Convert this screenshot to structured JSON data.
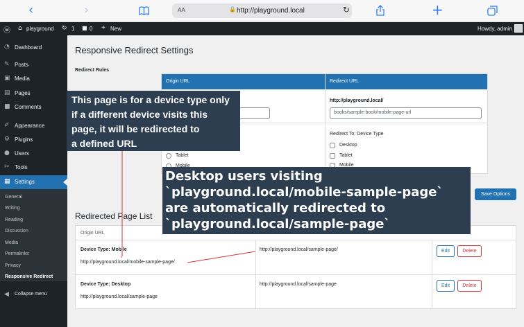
{
  "browser": {
    "back_icon": "chevron-left-icon",
    "forward_icon": "chevron-right-icon",
    "aa": "AA",
    "url": "http://playground.local",
    "share_icon": "share-icon",
    "plus_icon": "plus-icon",
    "tabs_icon": "tabs-icon"
  },
  "adminbar": {
    "site": "playground",
    "updates": "1",
    "comments": "0",
    "new": "New",
    "howdy": "Howdy, admin"
  },
  "sidebar": {
    "items": [
      {
        "label": "Dashboard",
        "icon": "dashboard-icon"
      },
      {
        "label": "Posts",
        "icon": "pin-icon"
      },
      {
        "label": "Media",
        "icon": "media-icon"
      },
      {
        "label": "Pages",
        "icon": "page-icon"
      },
      {
        "label": "Comments",
        "icon": "comment-icon"
      },
      {
        "label": "Appearance",
        "icon": "brush-icon"
      },
      {
        "label": "Plugins",
        "icon": "plugin-icon"
      },
      {
        "label": "Users",
        "icon": "user-icon"
      },
      {
        "label": "Tools",
        "icon": "wrench-icon"
      },
      {
        "label": "Settings",
        "icon": "settings-icon"
      }
    ],
    "submenu": [
      "General",
      "Writing",
      "Reading",
      "Discussion",
      "Media",
      "Permalinks",
      "Privacy",
      "Responsive Redirect"
    ],
    "collapse": "Collapse menu"
  },
  "main": {
    "page_title": "Responsive Redirect Settings",
    "rules_label": "Redirect Rules",
    "col_origin": "Origin URL",
    "col_redirect": "Redirect URL",
    "redirect_prefix": "http://playground.local/",
    "redirect_input": "books/sample-book/mobile-page-url",
    "redirect_to_label": "Redirect To: Device Type",
    "left_radios": [
      "Tablet",
      "Mobile"
    ],
    "right_checks": [
      "Desktop",
      "Tablet",
      "Mobile"
    ],
    "save_button": "Save Options",
    "list_title": "Redirected Page List",
    "list_col": "Origin URL",
    "rows": [
      {
        "device": "Device Type: Mobile",
        "origin": "http://playground.local/mobile-sample-page/",
        "target": "http://playground.local/sample-page/",
        "edit": "Edit",
        "delete": "Delete"
      },
      {
        "device": "Device Type: Desktop",
        "origin": "http://playground.local/sample-page",
        "target": "http://playground.local/sample-page",
        "edit": "Edit",
        "delete": "Delete"
      }
    ]
  },
  "annotations": {
    "note1": [
      "This page is for a device type only",
      "if a different device visits this",
      "page, it will be redirected to",
      "a defined URL"
    ],
    "note2": [
      "Desktop users visiting",
      "`playground.local/mobile-sample-page`",
      "are automatically redirected to",
      "`playground.local/sample-page`"
    ]
  },
  "colors": {
    "accent": "#2271b1",
    "admin_dark": "#1d2327",
    "delete": "#d63638",
    "annotation_bg": "#2c3e50"
  }
}
